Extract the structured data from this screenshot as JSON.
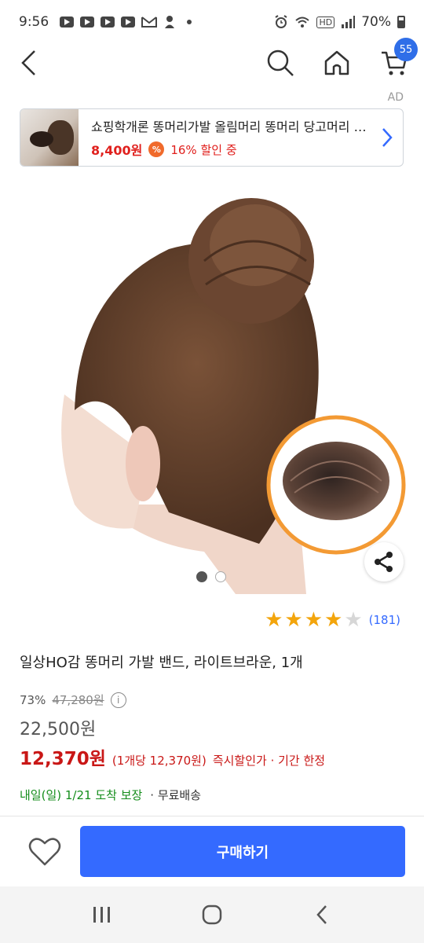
{
  "status_bar": {
    "time": "9:56",
    "battery": "70%",
    "hd_label": "HD"
  },
  "nav": {
    "cart_count": "55"
  },
  "ad": {
    "label": "AD",
    "title": "쇼핑학개론 똥머리가발 올림머리 똥머리 당고머리 똥머리가발",
    "price": "8,400원",
    "pct_icon": "%",
    "discount": "16% 할인 중"
  },
  "gallery": {
    "current": 1,
    "total": 2
  },
  "rating": {
    "stars": 4,
    "max": 5,
    "count": "(181)"
  },
  "product": {
    "title": "일상HO감 똥머리 가발 밴드, 라이트브라운, 1개",
    "discount_rate": "73%",
    "original_price": "47,280원",
    "info_icon": "i",
    "sale_price": "22,500원",
    "final_price": "12,370원",
    "unit_price": "(1개당 12,370원)",
    "instant_discount": "즉시할인가 · 기간 한정",
    "delivery_date": "내일(일) 1/21 도착 보장",
    "shipping": "· 무료배송"
  },
  "bottom_bar": {
    "buy_label": "구매하기"
  },
  "colors": {
    "accent": "#346aff",
    "price_red": "#c91716",
    "delivery_green": "#148d1b",
    "star": "#f3a50c"
  }
}
